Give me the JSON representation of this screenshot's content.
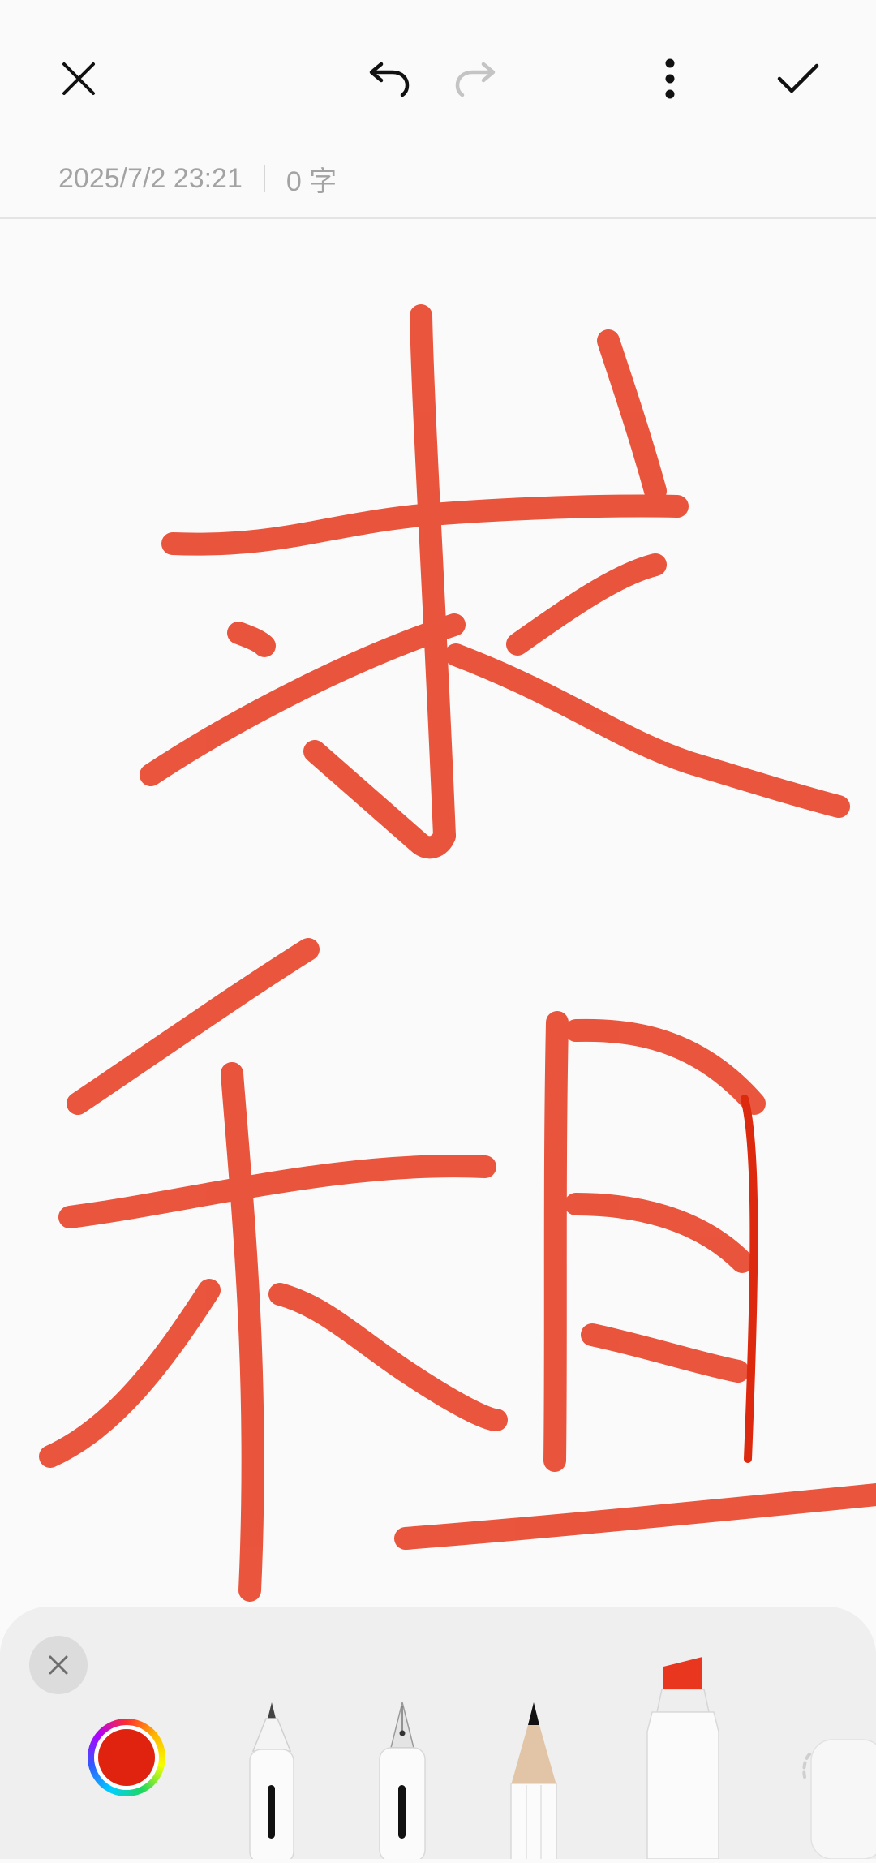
{
  "header": {
    "close_icon": "close-icon",
    "undo_icon": "undo-icon",
    "redo_icon": "redo-icon",
    "more_icon": "more-vertical-icon",
    "done_icon": "checkmark-icon"
  },
  "meta": {
    "timestamp": "2025/7/2 23:21",
    "word_count": "0 字"
  },
  "colors": {
    "ink": "#e8482f",
    "selected_pen_color": "#e0230e",
    "redo_disabled": "#c4c4c4"
  },
  "toolbar": {
    "close_icon": "close-icon",
    "color_picker_icon": "color-wheel-icon",
    "tools": [
      "ballpoint-pen",
      "fountain-pen",
      "pencil",
      "highlighter",
      "eraser"
    ]
  }
}
